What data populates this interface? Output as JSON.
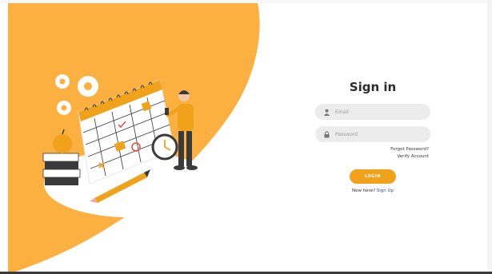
{
  "signin": {
    "title": "Sign in",
    "email_placeholder": "Email",
    "password_placeholder": "Password",
    "forgot_password": "Forgot Password?",
    "verify_account": "Verify Account",
    "login_label": "LOGIN",
    "new_here": "New here?",
    "sign_up": "Sign Up"
  },
  "colors": {
    "accent": "#f0a21b",
    "blob": "#fbb040",
    "link": "#3d4aa8",
    "field": "#ececec"
  },
  "icons": {
    "email": "user-icon",
    "password": "lock-icon"
  }
}
